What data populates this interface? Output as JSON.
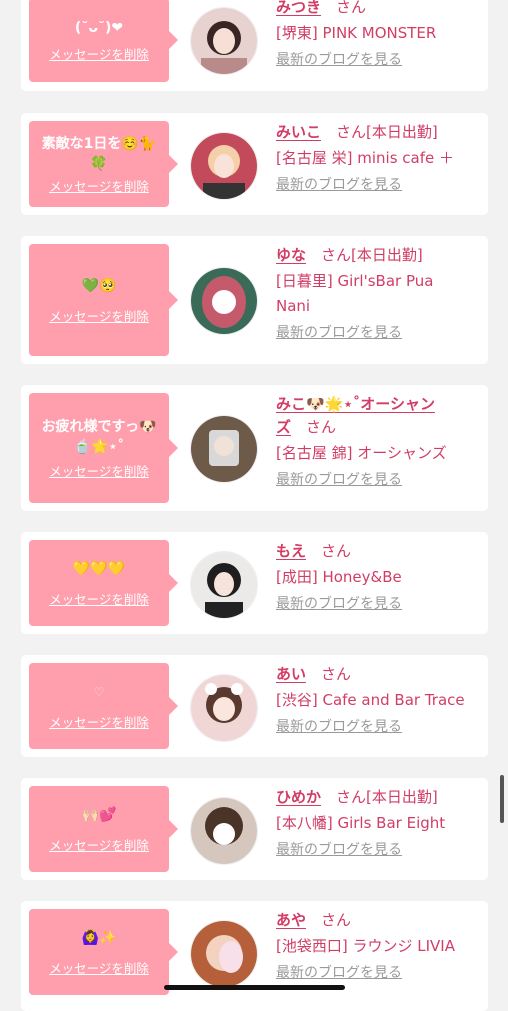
{
  "delete_label": "メッセージを削除",
  "blog_label": "最新のブログを見る",
  "colors": {
    "bubble": "#ff9fad",
    "accent": "#d23d66",
    "muted": "#9a9a9a"
  },
  "entries": [
    {
      "message": "(˘ᴗ˘)❤",
      "message2": "",
      "name": "みつき",
      "suffix": "さん",
      "shop": "[堺東] PINK MONSTER",
      "shop2": ""
    },
    {
      "message": "素敵な1日を☺️🐈",
      "message2": "🍀",
      "name": "みいこ",
      "suffix": "さん[本日出勤]",
      "shop": "[名古屋 栄] minis cafe ＋",
      "shop2": ""
    },
    {
      "message": "💚🥺",
      "message2": "",
      "name": "ゆな",
      "suffix": "さん[本日出勤]",
      "shop": "[日暮里] Girl'sBar Pua",
      "shop2": "Nani"
    },
    {
      "message": "お疲れ様ですっ🐶",
      "message2": "🍵🌟⋆˚",
      "name": "みこ🐶🌟⋆˚オーシャン",
      "name2": "ズ",
      "suffix": "さん",
      "shop": "[名古屋 錦] オーシャンズ",
      "shop2": ""
    },
    {
      "message": "💛💛💛",
      "message2": "",
      "name": "もえ",
      "suffix": "さん",
      "shop": "[成田] Honey&Be",
      "shop2": ""
    },
    {
      "message": "♡",
      "message2": "",
      "name": "あい",
      "suffix": "さん",
      "shop": "[渋谷] Cafe and Bar Trace",
      "shop2": ""
    },
    {
      "message": "🙌🏻💕",
      "message2": "",
      "name": "ひめか",
      "suffix": "さん[本日出勤]",
      "shop": "[本八幡] Girls Bar Eight",
      "shop2": ""
    },
    {
      "message": "🙆‍♀️✨",
      "message2": "",
      "name": "あや",
      "suffix": "さん",
      "shop": "[池袋西口] ラウンジ LIVIA",
      "shop2": ""
    }
  ]
}
